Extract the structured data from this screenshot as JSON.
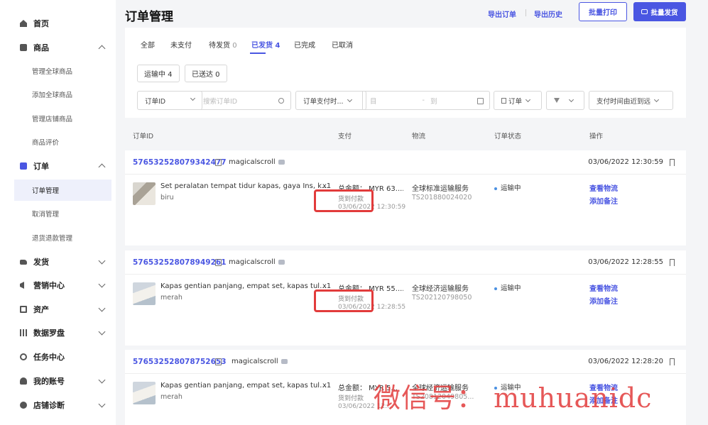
{
  "sidebar": {
    "items": [
      {
        "label": "首页",
        "icon": "home-icon"
      },
      {
        "label": "商品",
        "icon": "box-icon",
        "expanded": true,
        "children": [
          "管理全球商品",
          "添加全球商品",
          "管理店铺商品",
          "商品评价"
        ]
      },
      {
        "label": "订单",
        "icon": "order-icon",
        "expanded": true,
        "children": [
          "订单管理",
          "取消管理",
          "退货退款管理"
        ],
        "active_child": "订单管理"
      },
      {
        "label": "发货",
        "icon": "truck-icon"
      },
      {
        "label": "营销中心",
        "icon": "megaphone-icon"
      },
      {
        "label": "资产",
        "icon": "wallet-icon"
      },
      {
        "label": "数据罗盘",
        "icon": "chart-icon"
      },
      {
        "label": "任务中心",
        "icon": "medal-icon"
      },
      {
        "label": "我的账号",
        "icon": "user-icon"
      },
      {
        "label": "店铺诊断",
        "icon": "shop-icon"
      }
    ]
  },
  "header": {
    "title": "订单管理",
    "export_label": "导出订单",
    "export_history_label": "导出历史",
    "batch_print_label": "批量打印",
    "batch_ship_label": "批量发货"
  },
  "tabs": [
    {
      "label": "全部",
      "count": ""
    },
    {
      "label": "未支付",
      "count": ""
    },
    {
      "label": "待发货",
      "count": "0"
    },
    {
      "label": "已发货",
      "count": "4",
      "active": true
    },
    {
      "label": "已完成",
      "count": ""
    },
    {
      "label": "已取消",
      "count": ""
    }
  ],
  "subtabs": [
    {
      "label": "运输中 4"
    },
    {
      "label": "已送达 0"
    }
  ],
  "filters": {
    "id_type": "订单ID",
    "id_placeholder": "搜索订单ID",
    "time_type": "订单支付时...",
    "date_from": "目",
    "date_sep": "-",
    "date_to": "到",
    "order_type": "订单",
    "sort": "支付时间由近到远"
  },
  "columns": [
    "订单ID",
    "支付",
    "物流",
    "订单状态",
    "操作"
  ],
  "orders": [
    {
      "id": "576532528079342477",
      "buyer": "magicalscroll",
      "time": "03/06/2022 12:30:59",
      "product": "Set peralatan tempat tidur kapas, gaya Ins, kar...",
      "variant": "biru",
      "qty": "x1",
      "total": "总金额： MYR 63....",
      "pay_method": "货到付款",
      "pay_time": "03/06/2022 12:30:59",
      "shipping": "全球标准运输服务",
      "tracking": "TS201880024020",
      "status": "运输中",
      "actions": [
        "查看物流",
        "添加备注"
      ]
    },
    {
      "id": "576532528078949261",
      "buyer": "magicalscroll",
      "time": "03/06/2022 12:28:55",
      "product": "Kapas gentian panjang, empat set, kapas tulen...",
      "variant": "merah",
      "qty": "x1",
      "total": "总金额： MYR 55....",
      "pay_method": "货到付款",
      "pay_time": "03/06/2022 12:28:55",
      "shipping": "全球经济运输服务",
      "tracking": "TS202120798050",
      "status": "运输中",
      "actions": [
        "查看物流",
        "添加备注"
      ]
    },
    {
      "id": "576532528078752653",
      "buyer": "magicalscroll",
      "time": "03/06/2022 12:28:20",
      "product": "Kapas gentian panjang, empat set, kapas tulen...",
      "variant": "merah",
      "qty": "x1",
      "total": "总金额： MYR 5...",
      "pay_method": "货到付款",
      "pay_time": "03/06/2022 12:...",
      "shipping": "全球经济运输服务",
      "tracking": "TS20812049805...",
      "status": "运输中",
      "actions": [
        "查看物流",
        "添加备注"
      ]
    }
  ],
  "watermark": "微信号： muhuanidc",
  "colors": {
    "accent": "#4a56e2",
    "highlight": "#e23b3b"
  }
}
